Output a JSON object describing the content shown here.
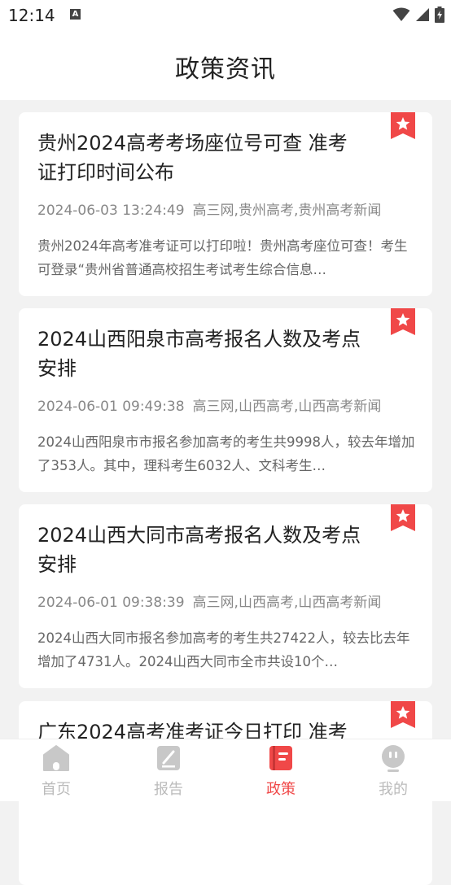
{
  "status_bar": {
    "time": "12:14",
    "notification_letter": "A"
  },
  "header": {
    "title": "政策资讯"
  },
  "articles": [
    {
      "title": "贵州2024高考考场座位号可查 准考证打印时间公布",
      "date": "2024-06-03 13:24:49",
      "tags": "高三网,贵州高考,贵州高考新闻",
      "summary": "贵州2024年高考准考证可以打印啦！贵州高考座位可查！考生可登录“贵州省普通高校招生考试考生综合信息…"
    },
    {
      "title": "2024山西阳泉市高考报名人数及考点安排",
      "date": "2024-06-01 09:49:38",
      "tags": "高三网,山西高考,山西高考新闻",
      "summary": "2024山西阳泉市市报名参加高考的考生共9998人，较去年增加了353人。其中，理科考生6032人、文科考生…"
    },
    {
      "title": "2024山西大同市高考报名人数及考点安排",
      "date": "2024-06-01 09:38:39",
      "tags": "高三网,山西高考,山西高考新闻",
      "summary": "2024山西大同市报名参加高考的考生共27422人，较去比去年增加了4731人。2024山西大同市全市共设10个…"
    },
    {
      "title": "广东2024高考准考证今日打印 准考",
      "date": "",
      "tags": "",
      "summary": ""
    }
  ],
  "tabs": [
    {
      "label": "首页",
      "icon": "home-icon"
    },
    {
      "label": "报告",
      "icon": "report-icon"
    },
    {
      "label": "政策",
      "icon": "policy-icon",
      "active": true
    },
    {
      "label": "我的",
      "icon": "profile-icon"
    }
  ],
  "colors": {
    "accent": "#f04848",
    "inactive": "#c8c8c8"
  }
}
